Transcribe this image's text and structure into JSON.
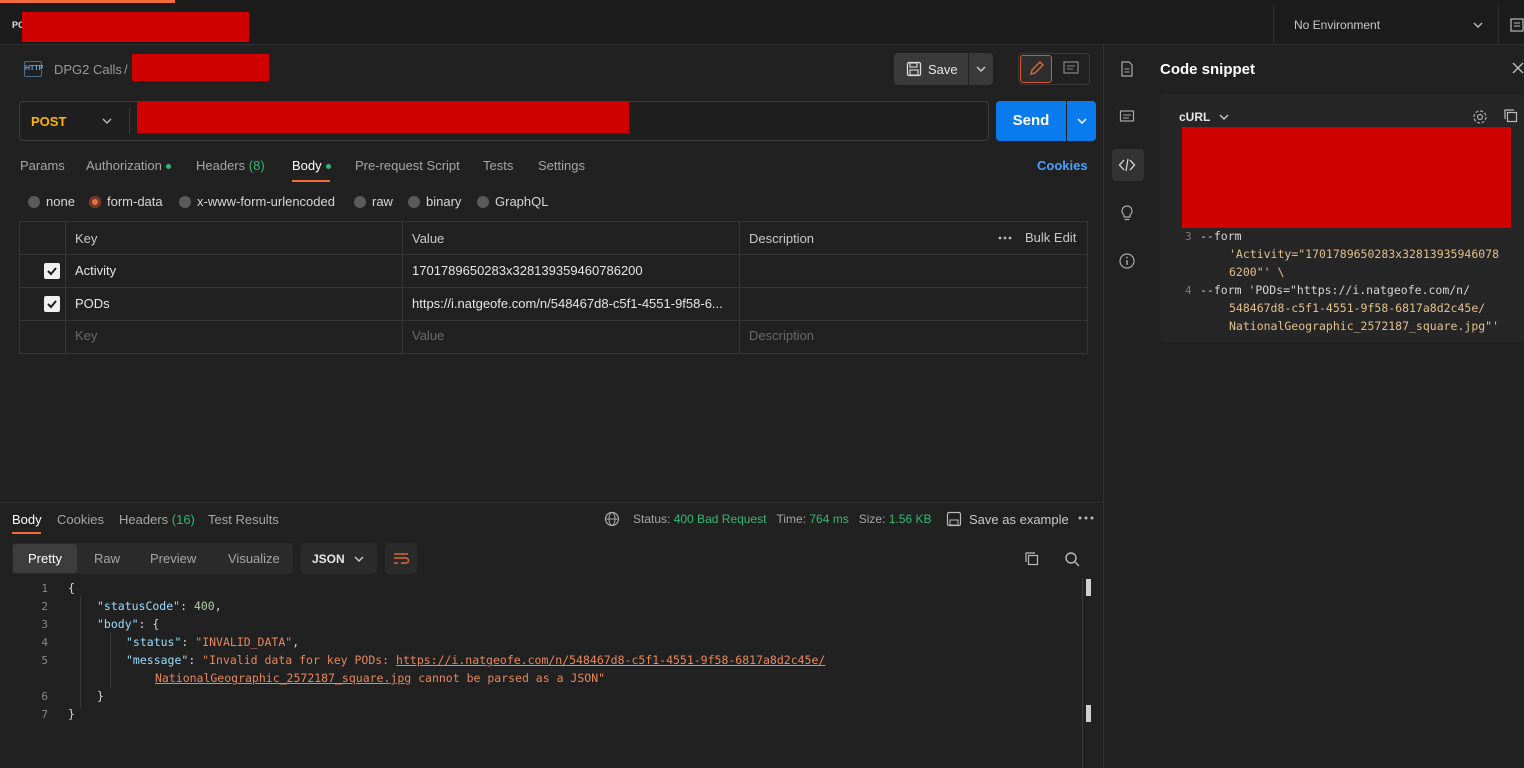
{
  "topbar": {
    "tab_fragment": "PC",
    "environment": "No Environment"
  },
  "breadcrumb": {
    "method_badge": "HTTP",
    "collection": "DPG2 Calls",
    "separator": "/"
  },
  "toolbar": {
    "save_label": "Save",
    "send_label": "Send"
  },
  "request": {
    "method": "POST",
    "tabs": [
      {
        "label": "Params"
      },
      {
        "label": "Authorization"
      },
      {
        "label": "Headers",
        "count": "(8)"
      },
      {
        "label": "Body"
      },
      {
        "label": "Pre-request Script"
      },
      {
        "label": "Tests"
      },
      {
        "label": "Settings"
      }
    ],
    "active_tab": "Body",
    "cookies_label": "Cookies",
    "body_types": [
      "none",
      "form-data",
      "x-www-form-urlencoded",
      "raw",
      "binary",
      "GraphQL"
    ],
    "selected_body_type": "form-data",
    "table": {
      "headers": {
        "key": "Key",
        "value": "Value",
        "description": "Description",
        "bulk_edit": "Bulk Edit"
      },
      "rows": [
        {
          "checked": true,
          "key": "Activity",
          "value": "1701789650283x328139359460786200",
          "description": ""
        },
        {
          "checked": true,
          "key": "PODs",
          "value": "https://i.natgeofe.com/n/548467d8-c5f1-4551-9f58-6...",
          "description": ""
        }
      ],
      "placeholders": {
        "key": "Key",
        "value": "Value",
        "description": "Description"
      }
    }
  },
  "response": {
    "tabs": [
      {
        "label": "Body"
      },
      {
        "label": "Cookies"
      },
      {
        "label": "Headers",
        "count": "(16)"
      },
      {
        "label": "Test Results"
      }
    ],
    "status_label": "Status:",
    "status_value": "400 Bad Request",
    "time_label": "Time:",
    "time_value": "764 ms",
    "size_label": "Size:",
    "size_value": "1.56 KB",
    "save_example": "Save as example",
    "view_modes": [
      "Pretty",
      "Raw",
      "Preview",
      "Visualize"
    ],
    "format": "JSON",
    "code": {
      "line_numbers": [
        "1",
        "2",
        "3",
        "4",
        "5",
        "6",
        "7"
      ],
      "open_brace": "{",
      "status_code_key": "\"statusCode\"",
      "status_code_value": "400",
      "body_key": "\"body\"",
      "status_key": "\"status\"",
      "status_value": "\"INVALID_DATA\"",
      "message_key": "\"message\"",
      "message_prefix": "\"Invalid data for key PODs: ",
      "message_url_1": "https://i.natgeofe.com/n/548467d8-c5f1-4551-9f58-6817a8d2c45e/",
      "message_url_2": "NationalGeographic_2572187_square.jpg",
      "message_suffix": " cannot be parsed as a JSON\"",
      "inner_close": "}",
      "close_brace": "}"
    }
  },
  "code_snippet": {
    "title": "Code snippet",
    "language": "cURL",
    "lines": [
      {
        "num": "3",
        "text": "--form"
      },
      {
        "num": "",
        "text": "'Activity=\"1701789650283x32813935946078"
      },
      {
        "num": "",
        "text": "6200\"' \\"
      },
      {
        "num": "4",
        "text": "--form 'PODs=\"https://i.natgeofe.com/n/"
      },
      {
        "num": "",
        "text": "548467d8-c5f1-4551-9f58-6817a8d2c45e/"
      },
      {
        "num": "",
        "text": "NationalGeographic_2572187_square.jpg\"'"
      }
    ]
  },
  "colors": {
    "accent": "#f26b3a",
    "primary": "#097bed",
    "method": "#ffb400",
    "success": "#2eb872",
    "redaction": "#d10000"
  }
}
